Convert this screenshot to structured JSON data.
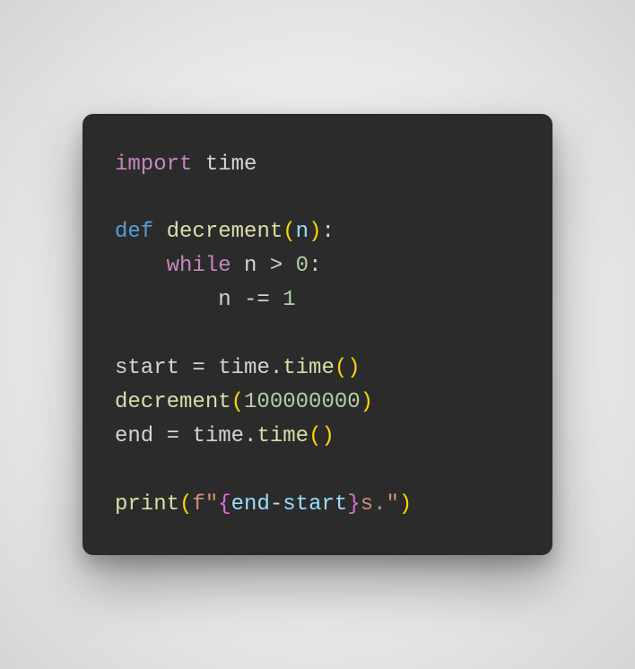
{
  "code": {
    "line1": {
      "import_kw": "import",
      "module": "time"
    },
    "line3": {
      "def_kw": "def",
      "func_name": "decrement",
      "lparen": "(",
      "param": "n",
      "rparen": ")",
      "colon": ":"
    },
    "line4": {
      "indent": "    ",
      "while_kw": "while",
      "var": "n",
      "op": ">",
      "num": "0",
      "colon": ":"
    },
    "line5": {
      "indent": "        ",
      "var": "n",
      "op": "-=",
      "num": "1"
    },
    "line7": {
      "var": "start",
      "eq": "=",
      "mod": "time",
      "dot": ".",
      "fn": "time",
      "lparen": "(",
      "rparen": ")"
    },
    "line8": {
      "fn": "decrement",
      "lparen": "(",
      "arg": "100000000",
      "rparen": ")"
    },
    "line9": {
      "var": "end",
      "eq": "=",
      "mod": "time",
      "dot": ".",
      "fn": "time",
      "lparen": "(",
      "rparen": ")"
    },
    "line11": {
      "fn": "print",
      "lparen": "(",
      "fprefix": "f\"",
      "lbrace": "{",
      "expr1": "end",
      "minus": "-",
      "expr2": "start",
      "rbrace": "}",
      "suffix": "s.\"",
      "rparen": ")"
    }
  }
}
